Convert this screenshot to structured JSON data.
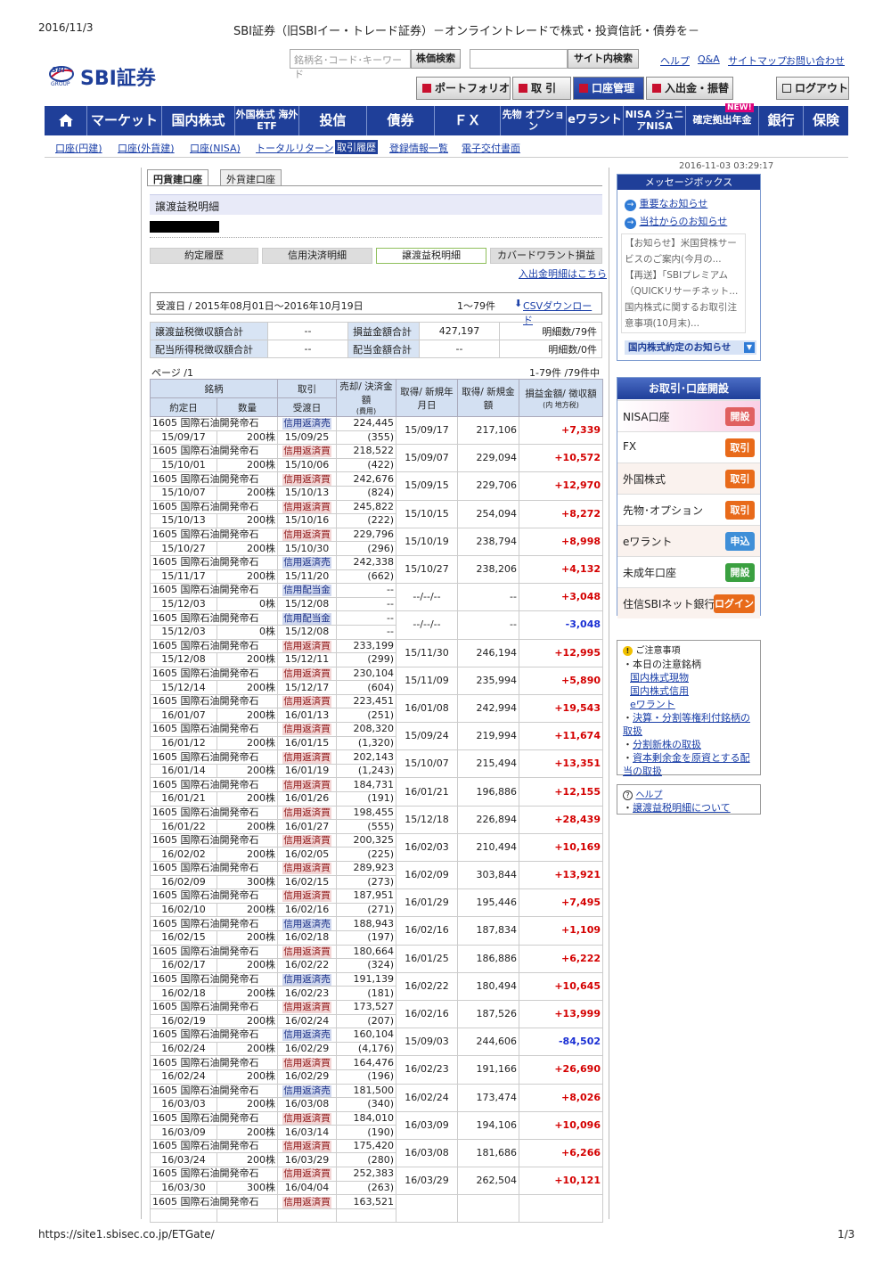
{
  "print": {
    "date": "2016/11/3",
    "title": "SBI証券（旧SBIイー・トレード証券）－オンライントレードで株式・投資信託・債券を－",
    "url": "https://site1.sbisec.co.jp/ETGate/",
    "page": "1/3"
  },
  "header": {
    "logo_badge": "SBI",
    "logo_group": "GROUP",
    "logo_text": "SBI証券",
    "search_placeholder": "銘柄名･コード･キーワード",
    "stock_search": "株価検索",
    "site_search": "サイト内検索",
    "links": [
      "ヘルプ",
      "Q&A",
      "サイトマップ",
      "お問い合わせ"
    ],
    "toolbar": [
      "ポートフォリオ",
      "取 引",
      "口座管理",
      "入出金・振替"
    ],
    "logout": "ログアウト"
  },
  "nav": {
    "items": [
      "マーケット",
      "国内株式",
      "外国株式 海外ETF",
      "投信",
      "債券",
      "ＦＸ",
      "先物 オプション",
      "eワラント",
      "NISA ジュニアNISA",
      "確定拠出年金",
      "銀行",
      "保険"
    ],
    "new_badge": "NEW!"
  },
  "subnav": [
    "口座(円建)",
    "口座(外貨建)",
    "口座(NISA)",
    "トータルリターン",
    "取引履歴",
    "登録情報一覧",
    "電子交付書面"
  ],
  "timestamp": "2016-11-03 03:29:17",
  "tabs": [
    "円貨建口座",
    "外貨建口座"
  ],
  "section_title": "譲渡益税明細",
  "buttons": [
    "約定履歴",
    "信用決済明細",
    "譲渡益税明細",
    "カバードワラント損益"
  ],
  "deposit_link": "入出金明細はこちら",
  "period": {
    "text": "受渡日 / 2015年08月01日～2016年10月19日",
    "count": "1～79件",
    "csv": "CSVダウンロード"
  },
  "summary": [
    [
      "譲渡益税徴収額合計",
      "--",
      "損益金額合計",
      "427,197",
      "明細数/79件"
    ],
    [
      "配当所得税徴収額合計",
      "--",
      "配当金額合計",
      "--",
      "明細数/0件"
    ]
  ],
  "pager": {
    "left": "ページ /1",
    "right": "1-79件 /79件中"
  },
  "table_headers": {
    "meigara": "銘柄",
    "torihiki": "取引",
    "baikyaku": "売却/ 決済金額",
    "hiyo": "(費用)",
    "shutoku_date": "取得/ 新規年月日",
    "shutoku_amt": "取得/ 新規金額",
    "soneki": "損益金額/ 徴収額",
    "chiho": "(内 地方税)",
    "yakujo": "約定日",
    "suryo": "数量",
    "ukewatashi": "受渡日"
  },
  "rows": [
    {
      "name": "1605 国際石油開発帝石",
      "type": "信用返済売",
      "amount": "224,445",
      "fee": "(355)",
      "date": "15/09/17",
      "qty": "200株",
      "settle": "15/09/25",
      "acq_date": "15/09/17",
      "acq_amount": "217,106",
      "pl": "+7,339"
    },
    {
      "name": "1605 国際石油開発帝石",
      "type": "信用返済買",
      "amount": "218,522",
      "fee": "(422)",
      "date": "15/10/01",
      "qty": "200株",
      "settle": "15/10/06",
      "acq_date": "15/09/07",
      "acq_amount": "229,094",
      "pl": "+10,572"
    },
    {
      "name": "1605 国際石油開発帝石",
      "type": "信用返済買",
      "amount": "242,676",
      "fee": "(824)",
      "date": "15/10/07",
      "qty": "200株",
      "settle": "15/10/13",
      "acq_date": "15/09/15",
      "acq_amount": "229,706",
      "pl": "+12,970"
    },
    {
      "name": "1605 国際石油開発帝石",
      "type": "信用返済買",
      "amount": "245,822",
      "fee": "(222)",
      "date": "15/10/13",
      "qty": "200株",
      "settle": "15/10/16",
      "acq_date": "15/10/15",
      "acq_amount": "254,094",
      "pl": "+8,272"
    },
    {
      "name": "1605 国際石油開発帝石",
      "type": "信用返済買",
      "amount": "229,796",
      "fee": "(296)",
      "date": "15/10/27",
      "qty": "200株",
      "settle": "15/10/30",
      "acq_date": "15/10/19",
      "acq_amount": "238,794",
      "pl": "+8,998"
    },
    {
      "name": "1605 国際石油開発帝石",
      "type": "信用返済売",
      "amount": "242,338",
      "fee": "(662)",
      "date": "15/11/17",
      "qty": "200株",
      "settle": "15/11/20",
      "acq_date": "15/10/27",
      "acq_amount": "238,206",
      "pl": "+4,132"
    },
    {
      "name": "1605 国際石油開発帝石",
      "type": "信用配当金",
      "amount": "--",
      "fee": "--",
      "date": "15/12/03",
      "qty": "0株",
      "settle": "15/12/08",
      "acq_date": "--/--/--",
      "acq_amount": "--",
      "pl": "+3,048"
    },
    {
      "name": "1605 国際石油開発帝石",
      "type": "信用配当金",
      "amount": "--",
      "fee": "--",
      "date": "15/12/03",
      "qty": "0株",
      "settle": "15/12/08",
      "acq_date": "--/--/--",
      "acq_amount": "--",
      "pl": "-3,048"
    },
    {
      "name": "1605 国際石油開発帝石",
      "type": "信用返済買",
      "amount": "233,199",
      "fee": "(299)",
      "date": "15/12/08",
      "qty": "200株",
      "settle": "15/12/11",
      "acq_date": "15/11/30",
      "acq_amount": "246,194",
      "pl": "+12,995"
    },
    {
      "name": "1605 国際石油開発帝石",
      "type": "信用返済買",
      "amount": "230,104",
      "fee": "(604)",
      "date": "15/12/14",
      "qty": "200株",
      "settle": "15/12/17",
      "acq_date": "15/11/09",
      "acq_amount": "235,994",
      "pl": "+5,890"
    },
    {
      "name": "1605 国際石油開発帝石",
      "type": "信用返済買",
      "amount": "223,451",
      "fee": "(251)",
      "date": "16/01/07",
      "qty": "200株",
      "settle": "16/01/13",
      "acq_date": "16/01/08",
      "acq_amount": "242,994",
      "pl": "+19,543"
    },
    {
      "name": "1605 国際石油開発帝石",
      "type": "信用返済買",
      "amount": "208,320",
      "fee": "(1,320)",
      "date": "16/01/12",
      "qty": "200株",
      "settle": "16/01/15",
      "acq_date": "15/09/24",
      "acq_amount": "219,994",
      "pl": "+11,674"
    },
    {
      "name": "1605 国際石油開発帝石",
      "type": "信用返済買",
      "amount": "202,143",
      "fee": "(1,243)",
      "date": "16/01/14",
      "qty": "200株",
      "settle": "16/01/19",
      "acq_date": "15/10/07",
      "acq_amount": "215,494",
      "pl": "+13,351"
    },
    {
      "name": "1605 国際石油開発帝石",
      "type": "信用返済買",
      "amount": "184,731",
      "fee": "(191)",
      "date": "16/01/21",
      "qty": "200株",
      "settle": "16/01/26",
      "acq_date": "16/01/21",
      "acq_amount": "196,886",
      "pl": "+12,155"
    },
    {
      "name": "1605 国際石油開発帝石",
      "type": "信用返済買",
      "amount": "198,455",
      "fee": "(555)",
      "date": "16/01/22",
      "qty": "200株",
      "settle": "16/01/27",
      "acq_date": "15/12/18",
      "acq_amount": "226,894",
      "pl": "+28,439"
    },
    {
      "name": "1605 国際石油開発帝石",
      "type": "信用返済買",
      "amount": "200,325",
      "fee": "(225)",
      "date": "16/02/02",
      "qty": "200株",
      "settle": "16/02/05",
      "acq_date": "16/02/03",
      "acq_amount": "210,494",
      "pl": "+10,169"
    },
    {
      "name": "1605 国際石油開発帝石",
      "type": "信用返済買",
      "amount": "289,923",
      "fee": "(273)",
      "date": "16/02/09",
      "qty": "300株",
      "settle": "16/02/15",
      "acq_date": "16/02/09",
      "acq_amount": "303,844",
      "pl": "+13,921"
    },
    {
      "name": "1605 国際石油開発帝石",
      "type": "信用返済買",
      "amount": "187,951",
      "fee": "(271)",
      "date": "16/02/10",
      "qty": "200株",
      "settle": "16/02/16",
      "acq_date": "16/01/29",
      "acq_amount": "195,446",
      "pl": "+7,495"
    },
    {
      "name": "1605 国際石油開発帝石",
      "type": "信用返済売",
      "amount": "188,943",
      "fee": "(197)",
      "date": "16/02/15",
      "qty": "200株",
      "settle": "16/02/18",
      "acq_date": "16/02/16",
      "acq_amount": "187,834",
      "pl": "+1,109"
    },
    {
      "name": "1605 国際石油開発帝石",
      "type": "信用返済買",
      "amount": "180,664",
      "fee": "(324)",
      "date": "16/02/17",
      "qty": "200株",
      "settle": "16/02/22",
      "acq_date": "16/01/25",
      "acq_amount": "186,886",
      "pl": "+6,222"
    },
    {
      "name": "1605 国際石油開発帝石",
      "type": "信用返済売",
      "amount": "191,139",
      "fee": "(181)",
      "date": "16/02/18",
      "qty": "200株",
      "settle": "16/02/23",
      "acq_date": "16/02/22",
      "acq_amount": "180,494",
      "pl": "+10,645"
    },
    {
      "name": "1605 国際石油開発帝石",
      "type": "信用返済買",
      "amount": "173,527",
      "fee": "(207)",
      "date": "16/02/19",
      "qty": "200株",
      "settle": "16/02/24",
      "acq_date": "16/02/16",
      "acq_amount": "187,526",
      "pl": "+13,999"
    },
    {
      "name": "1605 国際石油開発帝石",
      "type": "信用返済売",
      "amount": "160,104",
      "fee": "(4,176)",
      "date": "16/02/24",
      "qty": "200株",
      "settle": "16/02/29",
      "acq_date": "15/09/03",
      "acq_amount": "244,606",
      "pl": "-84,502"
    },
    {
      "name": "1605 国際石油開発帝石",
      "type": "信用返済買",
      "amount": "164,476",
      "fee": "(196)",
      "date": "16/02/24",
      "qty": "200株",
      "settle": "16/02/29",
      "acq_date": "16/02/23",
      "acq_amount": "191,166",
      "pl": "+26,690"
    },
    {
      "name": "1605 国際石油開発帝石",
      "type": "信用返済売",
      "amount": "181,500",
      "fee": "(340)",
      "date": "16/03/03",
      "qty": "200株",
      "settle": "16/03/08",
      "acq_date": "16/02/24",
      "acq_amount": "173,474",
      "pl": "+8,026"
    },
    {
      "name": "1605 国際石油開発帝石",
      "type": "信用返済買",
      "amount": "184,010",
      "fee": "(190)",
      "date": "16/03/09",
      "qty": "200株",
      "settle": "16/03/14",
      "acq_date": "16/03/09",
      "acq_amount": "194,106",
      "pl": "+10,096"
    },
    {
      "name": "1605 国際石油開発帝石",
      "type": "信用返済買",
      "amount": "175,420",
      "fee": "(280)",
      "date": "16/03/24",
      "qty": "200株",
      "settle": "16/03/29",
      "acq_date": "16/03/08",
      "acq_amount": "181,686",
      "pl": "+6,266"
    },
    {
      "name": "1605 国際石油開発帝石",
      "type": "信用返済買",
      "amount": "252,383",
      "fee": "(263)",
      "date": "16/03/30",
      "qty": "300株",
      "settle": "16/04/04",
      "acq_date": "16/03/29",
      "acq_amount": "262,504",
      "pl": "+10,121"
    },
    {
      "name": "1605 国際石油開発帝石",
      "type": "信用返済買",
      "amount": "163,521",
      "fee": "",
      "date": "",
      "qty": "",
      "settle": "",
      "acq_date": "",
      "acq_amount": "",
      "pl": ""
    }
  ],
  "message_box": {
    "title": "メッセージボックス",
    "links": [
      "重要なお知らせ",
      "当社からのお知らせ"
    ],
    "news": [
      "【お知らせ】米国貸株サービスのご案内(今月の...",
      "【再送】「SBIプレミアム（QUICKリサーチネット...",
      "国内株式に関するお取引注意事項(10月末)..."
    ],
    "footer": "国内株式約定のお知らせ"
  },
  "account_box": {
    "title": "お取引･口座開設",
    "items": [
      {
        "label": "NISA口座",
        "btn": "開設"
      },
      {
        "label": "FX",
        "btn": "取引"
      },
      {
        "label": "外国株式",
        "btn": "取引"
      },
      {
        "label": "先物･オプション",
        "btn": "取引"
      },
      {
        "label": "eワラント",
        "btn": "申込"
      },
      {
        "label": "未成年口座",
        "btn": "開設"
      },
      {
        "label": "住信SBIネット銀行",
        "btn": "ログイン"
      }
    ]
  },
  "notice": {
    "title": "ご注意事項",
    "intro": "本日の注意銘柄",
    "links": [
      "国内株式現物",
      "国内株式信用",
      "eワラント",
      "決算・分割等権利付銘柄の取扱",
      "分割新株の取扱",
      "資本剰余金を原資とする配当の取扱"
    ]
  },
  "help": {
    "title": "ヘルプ",
    "link": "譲渡益税明細について"
  },
  "colors": {
    "nav": "#1f3f99",
    "positive": "#d40000",
    "negative": "#1a2fd4",
    "header_cell": "#d3e0f2"
  }
}
